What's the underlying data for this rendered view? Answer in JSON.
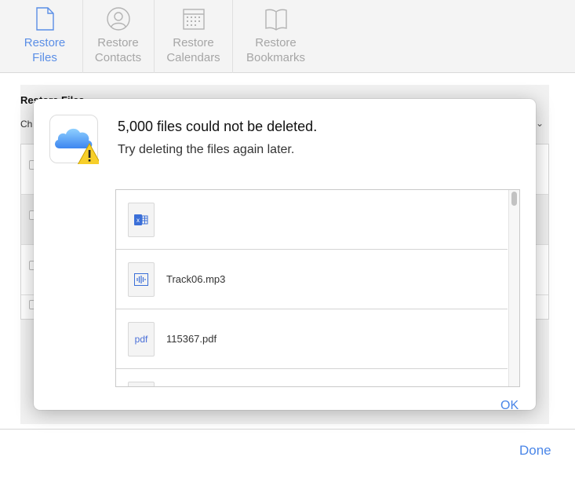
{
  "toolbar": {
    "items": [
      {
        "label": "Restore\nFiles",
        "icon": "document-icon",
        "active": true
      },
      {
        "label": "Restore\nContacts",
        "icon": "contact-icon",
        "active": false
      },
      {
        "label": "Restore\nCalendars",
        "icon": "calendar-icon",
        "active": false
      },
      {
        "label": "Restore\nBookmarks",
        "icon": "book-icon",
        "active": false
      }
    ]
  },
  "background": {
    "title": "Restore Files",
    "choose_text": "Ch",
    "chevron": "l ⌄",
    "done_label": "Done"
  },
  "dialog": {
    "title": "5,000 files could not be deleted.",
    "message": "Try deleting the files again later.",
    "icon": "icloud-warning-icon",
    "files": [
      {
        "name": "",
        "icon": "excel-file-icon"
      },
      {
        "name": "Track06.mp3",
        "icon": "audio-file-icon"
      },
      {
        "name": "115367.pdf",
        "icon": "pdf-file-icon",
        "badge": "pdf"
      },
      {
        "name": "",
        "icon": "file-icon"
      }
    ],
    "ok_label": "OK"
  },
  "colors": {
    "accent": "#4a86e8",
    "toolbar_bg": "#f4f4f4",
    "inactive": "#a6a6a6"
  }
}
